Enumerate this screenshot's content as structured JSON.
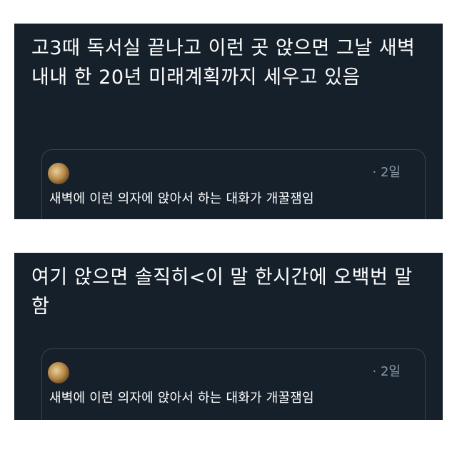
{
  "posts": [
    {
      "text": "고3때 독서실 끝나고 이런 곳 앉으면 그날 새벽 내내 한 20년 미래계획까지 세우고 있음",
      "quote": {
        "timestamp": "· 2일",
        "text": "새벽에 이런 의자에 앉아서 하는 대화가 개꿀잼임"
      }
    },
    {
      "text": "여기 앉으면 솔직히<이 말 한시간에 오백번 말함",
      "quote": {
        "timestamp": "· 2일",
        "text": "새벽에 이런 의자에 앉아서 하는 대화가 개꿀잼임"
      }
    }
  ],
  "colors": {
    "card_background": "#15202b",
    "text_primary": "#ffffff",
    "text_secondary": "#8b98a5",
    "quote_border": "#38444d"
  }
}
